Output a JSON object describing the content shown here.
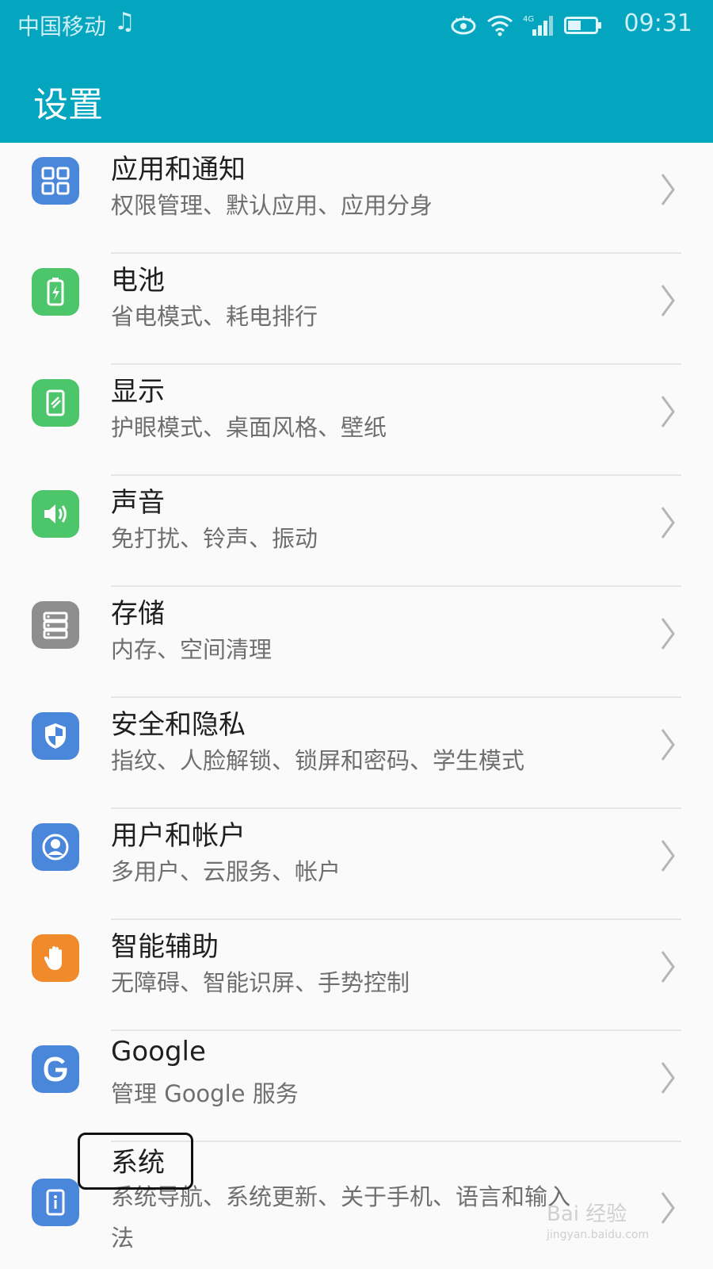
{
  "status": {
    "carrier": "中国移动",
    "music_icon": "music-note-icon",
    "time": "09:31"
  },
  "header": {
    "title": "设置"
  },
  "colors": {
    "accent": "#04a6bf"
  },
  "items": [
    {
      "title": "应用和通知",
      "subtitle": "权限管理、默认应用、应用分身",
      "icon": "apps-grid-icon",
      "color": "#4a86d9"
    },
    {
      "title": "电池",
      "subtitle": "省电模式、耗电排行",
      "icon": "battery-icon",
      "color": "#4cc56b"
    },
    {
      "title": "显示",
      "subtitle": "护眼模式、桌面风格、壁纸",
      "icon": "display-icon",
      "color": "#4cc56b"
    },
    {
      "title": "声音",
      "subtitle": "免打扰、铃声、振动",
      "icon": "speaker-icon",
      "color": "#4cc56b"
    },
    {
      "title": "存储",
      "subtitle": "内存、空间清理",
      "icon": "storage-icon",
      "color": "#8e8e8e"
    },
    {
      "title": "安全和隐私",
      "subtitle": "指纹、人脸解锁、锁屏和密码、学生模式",
      "icon": "shield-icon",
      "color": "#4a86d9"
    },
    {
      "title": "用户和帐户",
      "subtitle": "多用户、云服务、帐户",
      "icon": "user-icon",
      "color": "#4a86d9"
    },
    {
      "title": "智能辅助",
      "subtitle": "无障碍、智能识屏、手势控制",
      "icon": "hand-icon",
      "color": "#f08a2a"
    },
    {
      "title": "Google",
      "subtitle": "管理 Google 服务",
      "icon": "google-icon",
      "color": "#4a86d9"
    },
    {
      "title": "系统",
      "subtitle": "系统导航、系统更新、关于手机、语言和输入",
      "subtitle_line2": "法",
      "icon": "system-icon",
      "color": "#4a86d9"
    }
  ],
  "watermark": {
    "text": "Bai 经验",
    "url": "jingyan.baidu.com"
  }
}
